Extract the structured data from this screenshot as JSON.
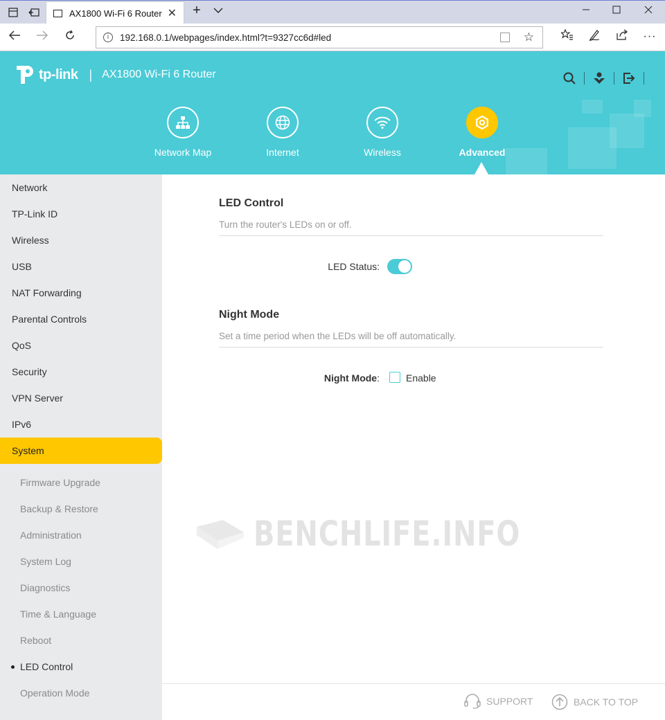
{
  "browser": {
    "tab_title": "AX1800 Wi-Fi 6 Router",
    "url": "192.168.0.1/webpages/index.html?t=9327cc6d#led"
  },
  "header": {
    "brand": "tp-link",
    "model": "AX1800 Wi-Fi 6 Router",
    "nav": [
      {
        "label": "Network Map",
        "icon": "network-map-icon"
      },
      {
        "label": "Internet",
        "icon": "globe-icon"
      },
      {
        "label": "Wireless",
        "icon": "wifi-icon"
      },
      {
        "label": "Advanced",
        "icon": "gear-icon",
        "active": true
      }
    ]
  },
  "sidebar": {
    "items": [
      {
        "label": "Network"
      },
      {
        "label": "TP-Link ID"
      },
      {
        "label": "Wireless"
      },
      {
        "label": "USB"
      },
      {
        "label": "NAT Forwarding"
      },
      {
        "label": "Parental Controls"
      },
      {
        "label": "QoS"
      },
      {
        "label": "Security"
      },
      {
        "label": "VPN Server"
      },
      {
        "label": "IPv6"
      },
      {
        "label": "System",
        "active": true
      }
    ],
    "sub_items": [
      {
        "label": "Firmware Upgrade"
      },
      {
        "label": "Backup & Restore"
      },
      {
        "label": "Administration"
      },
      {
        "label": "System Log"
      },
      {
        "label": "Diagnostics"
      },
      {
        "label": "Time & Language"
      },
      {
        "label": "Reboot"
      },
      {
        "label": "LED Control",
        "current": true
      },
      {
        "label": "Operation Mode"
      }
    ]
  },
  "main": {
    "led": {
      "title": "LED Control",
      "description": "Turn the router's LEDs on or off.",
      "status_label": "LED Status:",
      "status_on": true
    },
    "night": {
      "title": "Night Mode",
      "description": "Set a time period when the LEDs will be off automatically.",
      "label": "Night Mode",
      "label_colon": ":",
      "enable_label": "Enable",
      "enabled": false
    },
    "watermark": "BENCHLIFE.INFO"
  },
  "footer": {
    "support": "SUPPORT",
    "back_to_top": "BACK TO TOP"
  },
  "colors": {
    "accent": "#4acbd6",
    "highlight": "#ffc700",
    "sidebar_bg": "#e9eaeb"
  }
}
